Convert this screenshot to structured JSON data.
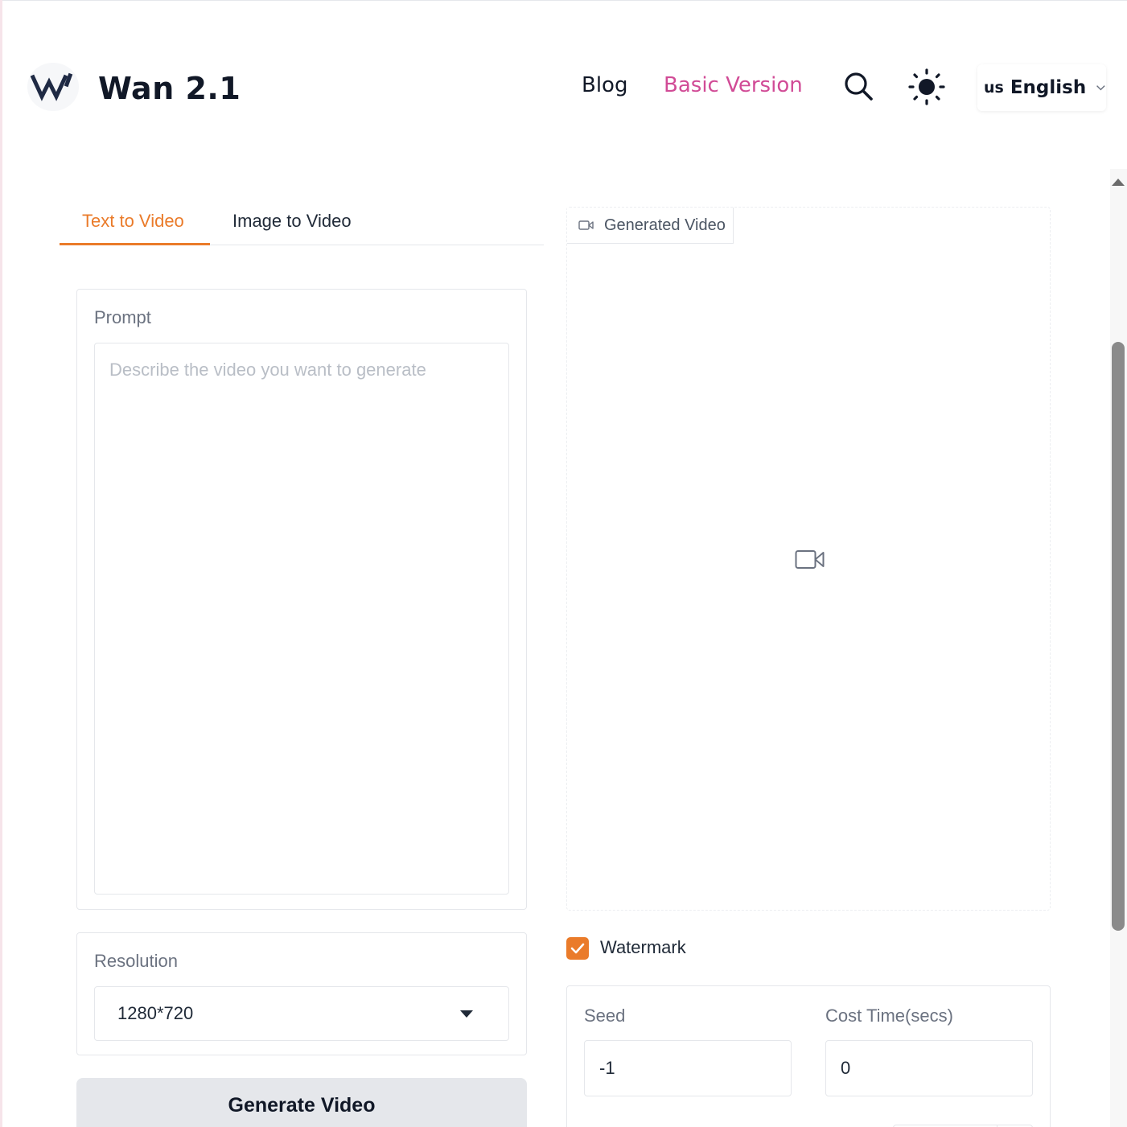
{
  "header": {
    "brand": "Wan 2.1",
    "nav": {
      "blog": "Blog",
      "basic_version": "Basic Version"
    },
    "language": {
      "flag": "us",
      "label": "English"
    }
  },
  "tabs": [
    {
      "label": "Text to Video",
      "active": true
    },
    {
      "label": "Image to Video",
      "active": false
    }
  ],
  "prompt": {
    "label": "Prompt",
    "placeholder": "Describe the video you want to generate",
    "value": ""
  },
  "resolution": {
    "label": "Resolution",
    "value": "1280*720"
  },
  "generate_button": "Generate Video",
  "output": {
    "tab_label": "Generated Video"
  },
  "watermark": {
    "label": "Watermark",
    "checked": true
  },
  "seed": {
    "label": "Seed",
    "value": "-1"
  },
  "cost_time": {
    "label": "Cost Time(secs)",
    "value": "0"
  },
  "colors": {
    "accent_orange": "#ea7b2a",
    "nav_pink": "#d14b96",
    "button_gray": "#e5e7eb"
  },
  "icons": [
    "brand-logo-icon",
    "search-icon",
    "sun-icon",
    "chevron-down-icon",
    "video-camera-icon",
    "checkmark-icon",
    "caret-down-icon"
  ]
}
